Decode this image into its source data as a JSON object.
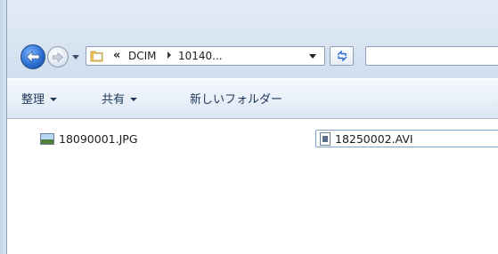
{
  "nav": {
    "back_icon": "back-arrow-icon",
    "forward_icon": "forward-arrow-icon",
    "history_icon": "chevron-down-icon",
    "refresh_icon": "refresh-arrows-icon"
  },
  "address": {
    "overflow_glyph": "«",
    "crumbs": [
      "DCIM",
      "10140..."
    ],
    "dropdown_icon": "chevron-down-icon",
    "folder_icon": "folder-icon"
  },
  "search": {
    "value": ""
  },
  "toolbar": {
    "organize_label": "整理",
    "share_label": "共有",
    "new_folder_label": "新しいフォルダー"
  },
  "files": [
    {
      "name": "18090001.JPG",
      "type": "jpg",
      "selected": false
    },
    {
      "name": "18250002.AVI",
      "type": "avi",
      "selected": true
    }
  ],
  "colors": {
    "toolbar_text": "#1e395b",
    "frame_blue": "#dbe6f3",
    "selection_border": "#7da2ce"
  }
}
